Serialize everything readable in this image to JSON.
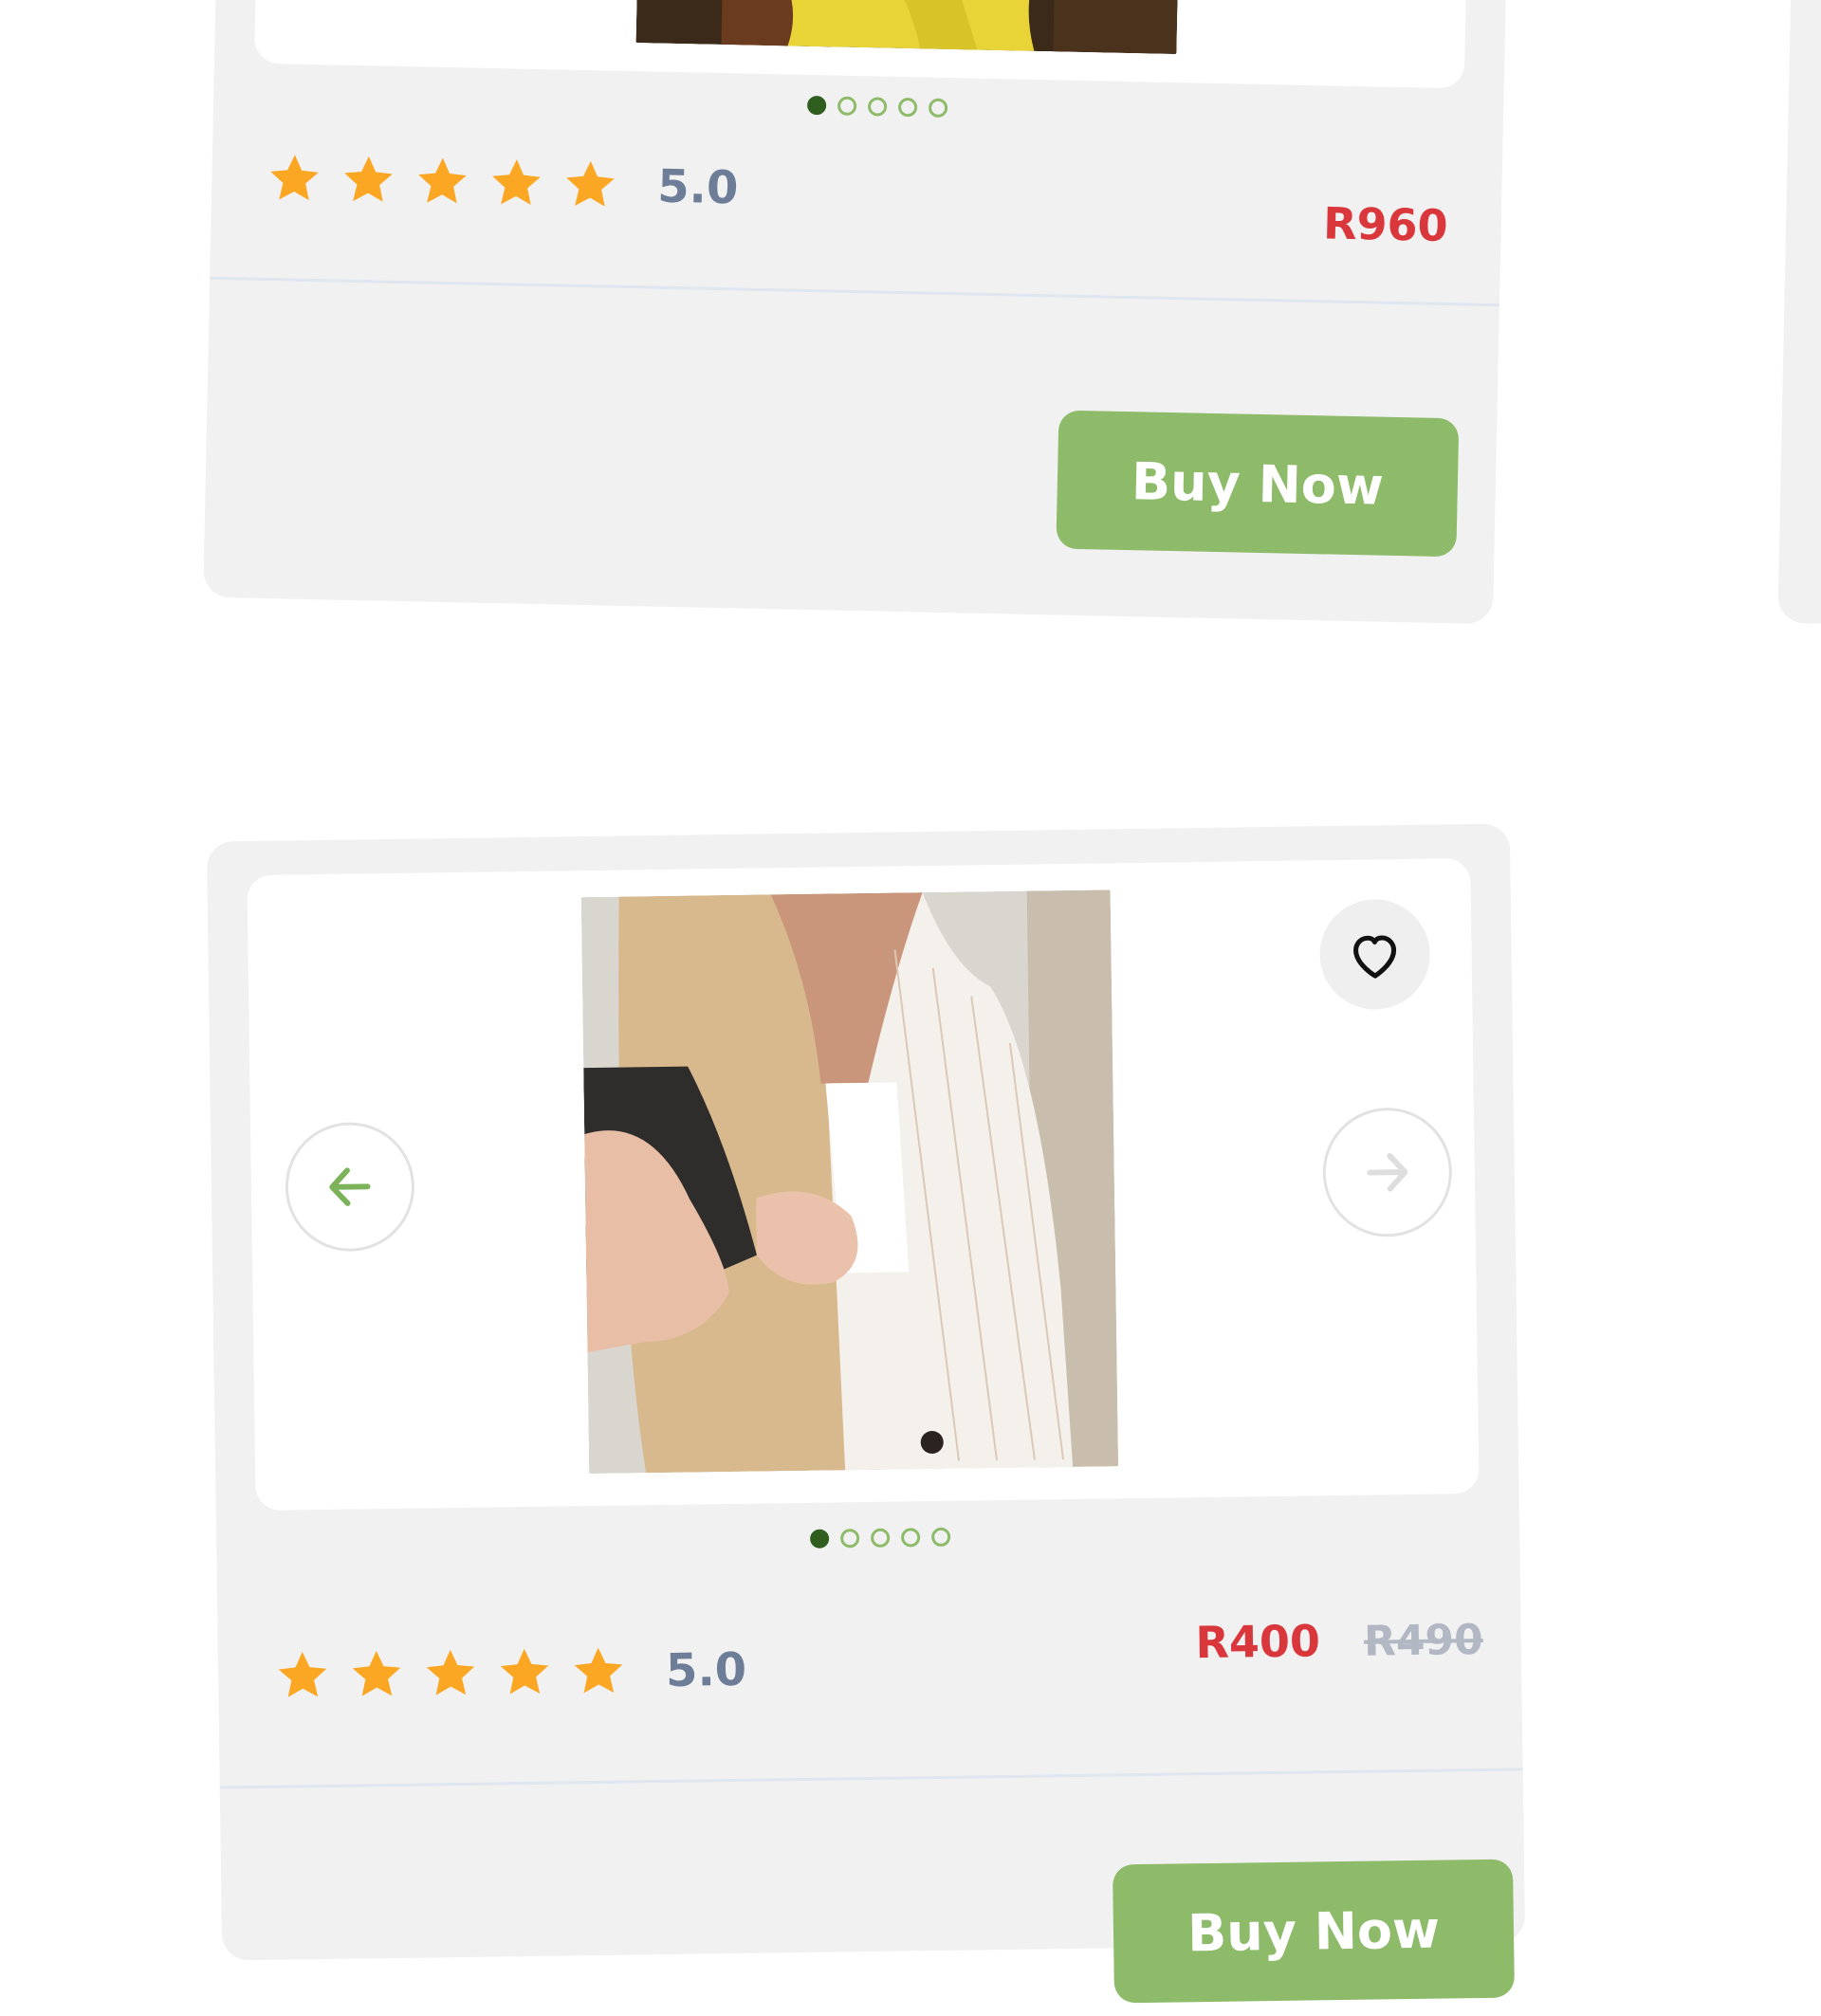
{
  "colors": {
    "card_background": "#f1f1f1",
    "panel_background": "#ffffff",
    "star": "#fba724",
    "rating_text": "#6e7d97",
    "price": "#d9373c",
    "old_price": "#b2b8c3",
    "button_background": "#8dbb6a",
    "button_text": "#ffffff",
    "dot_active": "#2f5e1e",
    "dot_inactive": "#8ebb6a",
    "arrow_active": "#7cb35a",
    "arrow_disabled": "#dedede"
  },
  "products": [
    {
      "image": {
        "description_icon": "product-photo-yellow-outfit"
      },
      "carousel": {
        "total_slides": 5,
        "active_index": 0
      },
      "rating": {
        "stars": 5,
        "value": "5.0"
      },
      "price": "R960",
      "old_price": "",
      "buy_label": "Buy Now"
    },
    {
      "image": {
        "description_icon": "product-photo-blazer"
      },
      "carousel": {
        "total_slides": 5,
        "active_index": 0
      },
      "favorite": {
        "icon": "heart-outline-icon"
      },
      "nav": {
        "prev_icon": "arrow-left-icon",
        "next_icon": "arrow-right-icon",
        "next_disabled": true
      },
      "rating": {
        "stars": 5,
        "value": "5.0"
      },
      "price": "R400",
      "old_price": "R490",
      "buy_label": "Buy Now"
    }
  ]
}
